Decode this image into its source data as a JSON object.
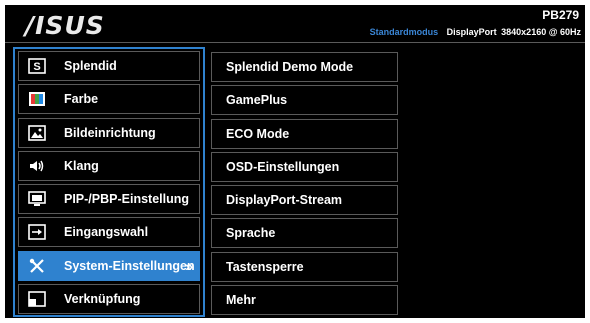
{
  "header": {
    "logo": "/ISUS",
    "model": "PB279",
    "status_mode": "Standardmodus",
    "status_input": "DisplayPort",
    "status_resolution": "3840x2160 @ 60Hz"
  },
  "main_menu": [
    {
      "label": "Splendid",
      "icon": "splendid-icon"
    },
    {
      "label": "Farbe",
      "icon": "color-icon"
    },
    {
      "label": "Bildeinrichtung",
      "icon": "image-icon"
    },
    {
      "label": "Klang",
      "icon": "speaker-icon"
    },
    {
      "label": "PIP-/PBP-Einstellung",
      "icon": "pip-icon"
    },
    {
      "label": "Eingangswahl",
      "icon": "input-icon"
    },
    {
      "label": "System-Einstellungen",
      "icon": "wrench-icon",
      "selected": true
    },
    {
      "label": "Verknüpfung",
      "icon": "shortcut-icon"
    }
  ],
  "submenu": [
    {
      "label": "Splendid Demo Mode"
    },
    {
      "label": "GamePlus"
    },
    {
      "label": "ECO Mode"
    },
    {
      "label": "OSD-Einstellungen"
    },
    {
      "label": "DisplayPort-Stream"
    },
    {
      "label": "Sprache"
    },
    {
      "label": "Tastensperre"
    },
    {
      "label": "Mehr"
    }
  ],
  "colors": {
    "accent": "#2f82cf",
    "background": "#000000",
    "border": "#5a5a5a"
  }
}
